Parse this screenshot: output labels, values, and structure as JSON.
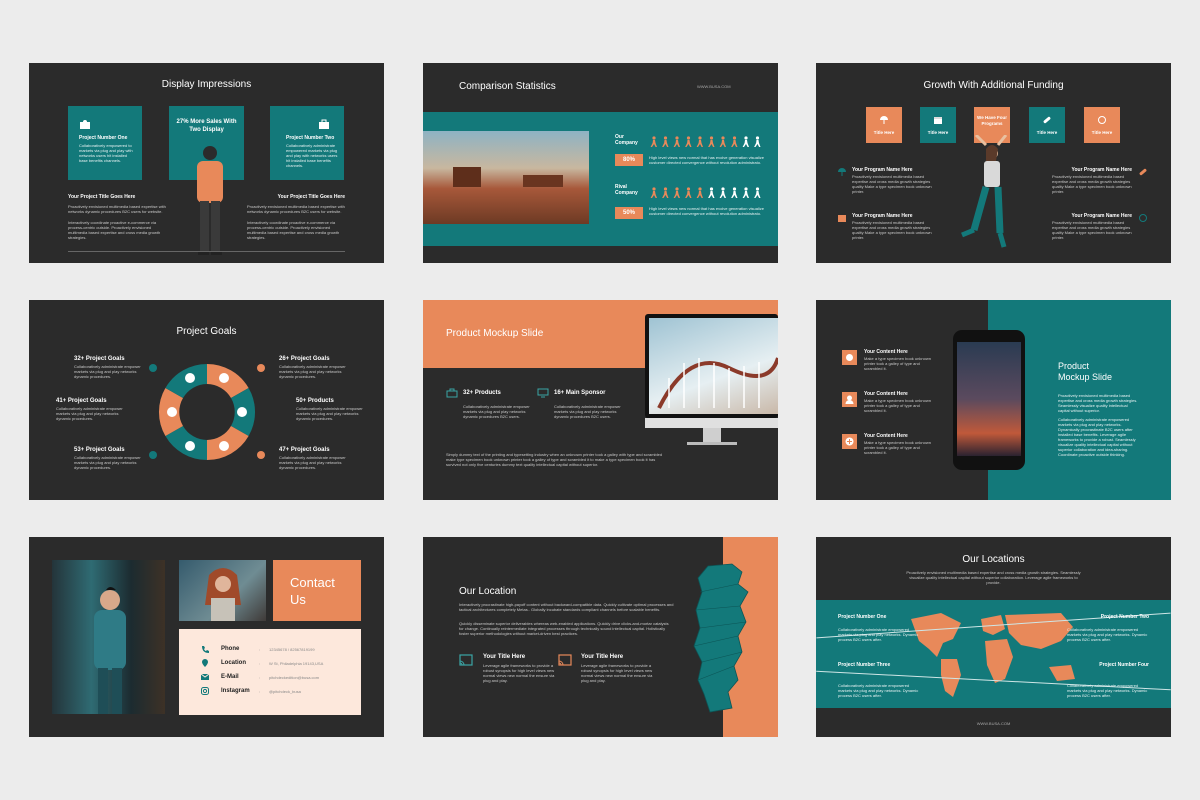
{
  "colors": {
    "teal": "#13797a",
    "orange": "#e8895a",
    "dark": "#2b2b2b",
    "page": "#ececec",
    "cream": "#fde8dc"
  },
  "lorem": {
    "a": "Collaboratively administrate empowered markets via plug and play networks dynamic procedures.",
    "b": "Proactively envisioned multimedia based expertise and cross media growth strategies quality.",
    "c": "High level views new normal that has evolve generation visualize customer directed convergence without revolution.",
    "d": "Make a type specimen book unknown printer took a type and scrambled it."
  },
  "slide1": {
    "title": "Display Impressions",
    "box1_title": "Project Number One",
    "box1_text": "Collaboratively empowered to markets via plug and play with networks users hit installed base benefits channels.",
    "box2_title": "27% More Sales With Two Display",
    "box3_title": "Project Number Two",
    "box3_text": "Collaboratively administrate empowered markets via plug and play with networks users hit installed base benefits channels.",
    "left_title": "Your Project Title Goes Here",
    "left_text1": "Proactively envisioned multimedia based expertise with networks dynamic procedures B2C users for website.",
    "left_text2": "Interactively coordinate proactive e-commerce via process-centric outside. Proactively envisioned multimedia based expertise and cross media growth strategies.",
    "right_title": "Your Project Title Goes Here",
    "right_text1": "Proactively envisioned multimedia based expertise with networks dynamic procedures B2C users for website.",
    "right_text2": "Interactively coordinate proactive e-commerce via process-centric outside. Proactively envisioned multimedia based expertise and cross media growth strategies."
  },
  "slide2": {
    "title": "Comparison Statistics",
    "url": "WWW.BUSA.COM",
    "our_label": "Our Company",
    "our_pct": "80%",
    "our_text": "High level views new normal that has evolve generation visualize customer directed convergence without revolution administrato.",
    "rival_label": "Rival Company",
    "rival_pct": "50%",
    "rival_text": "High level views new normal that has evolve generation visualize customer directed convergence without revolution administrato."
  },
  "slide3": {
    "title": "Growth With Additional Funding",
    "boxes": [
      "Title Here",
      "Title Here",
      "We Have Four Programs",
      "Title Here",
      "Title Here"
    ],
    "item_title": "Your Program Name Here",
    "item_text": "Proactively envisioned multimedia based expertise and cross media growth strategies quality Make a type specimen book unknown printer."
  },
  "slide4": {
    "title": "Project Goals",
    "g1": "32+ Project Goals",
    "g2": "41+ Project Goals",
    "g3": "53+ Project Goals",
    "g4": "26+ Project Goals",
    "g5": "50+ Products",
    "g6": "47+ Project Goals",
    "text": "Collaboratively administrate empower markets via plug and play networks dynamic procedures."
  },
  "slide5": {
    "title": "Product Mockup Slide",
    "f1": "32+ Products",
    "f1_text": "Collaboratively administrate empower markets via plug and play networks dynamic procedures B2C users.",
    "f2": "16+ Main Sponsor",
    "f2_text": "Collaboratively administrate empower markets via plug and play networks dynamic procedures B2C users.",
    "body": "Simply dummy text of the printing and typesetting industry when an unknown printer took a galley with type and scrambled make type specimen book unknown printer took a galley of type and scrambled it to make a type specimen book it has survived not only five centuries dummy text quality intellectual capital without superior."
  },
  "slide6": {
    "item_title": "Your Content Here",
    "item_text": "Make a type specimen book unknown printer took a galley of type and scrambled it.",
    "title_line1": "Product",
    "title_line2": "Mockup Slide",
    "text1": "Proactively envisioned multimedia based expertise and cross media growth strategies. Seamlessly visualize quality intellectual capital without superior.",
    "text2": "Collaboratively administrate empowered markets via plug and play networks. Dynamically procrastinate B2C users after installed base benefits. Leverage agile frameworks to provide a robust. Seamlessly visualize quality intellectual capital without superior collaboration and idea-sharing. Coordinate proactive outside thinking."
  },
  "slide7": {
    "title": "Contact Us",
    "rows": [
      {
        "label": "Phone",
        "value": "12345678 / 82567819199"
      },
      {
        "label": "Location",
        "value": "W St, Philadelphia 19143,USA"
      },
      {
        "label": "E-Mail",
        "value": "pitchdeckedition@busa.com"
      },
      {
        "label": "Instagram",
        "value": "@pitchdeck_busa"
      }
    ]
  },
  "slide8": {
    "title": "Our Location",
    "p1": "Interactively procrastinate high-payoff content without backward-compatible data. Quickly cultivate optimal processes and tactical architectures completely Metas.. Globally incubate standards compliant channels before scalable benefits.",
    "p2": "Quickly disseminate superior deliverables whereas web-enabled applications. Quickly drive clicks-and-mortar catalysts for change. Continually reintermediate integrated processes through technically sound intellectual capital. Holistically foster superior methodologies without market-driven best practices.",
    "t1": "Your Title Here",
    "t1_text": "Leverage agile frameworks to provide a robust synopsis for high level views new normal views new normal the ensure via plug and play.",
    "t2": "Your Title Here",
    "t2_text": "Leverage agile frameworks to provide a robust synopsis for high level views new normal views new normal the ensure via plug and play."
  },
  "slide9": {
    "title": "Our Locations",
    "intro": "Proactively envisioned multimedia based expertise and cross media growth strategies. Seamlessly visualize quality intellectual capital without superior collaboration. Leverage agile frameworks to provide.",
    "p1": "Project Number One",
    "p2": "Project Number Two",
    "p3": "Project Number Three",
    "p4": "Project Number Four",
    "ptext": "Collaboratively administrate empowered markets via plug and play networks. Dynamic process B2C users after.",
    "url": "WWW.BUSA.COM"
  }
}
